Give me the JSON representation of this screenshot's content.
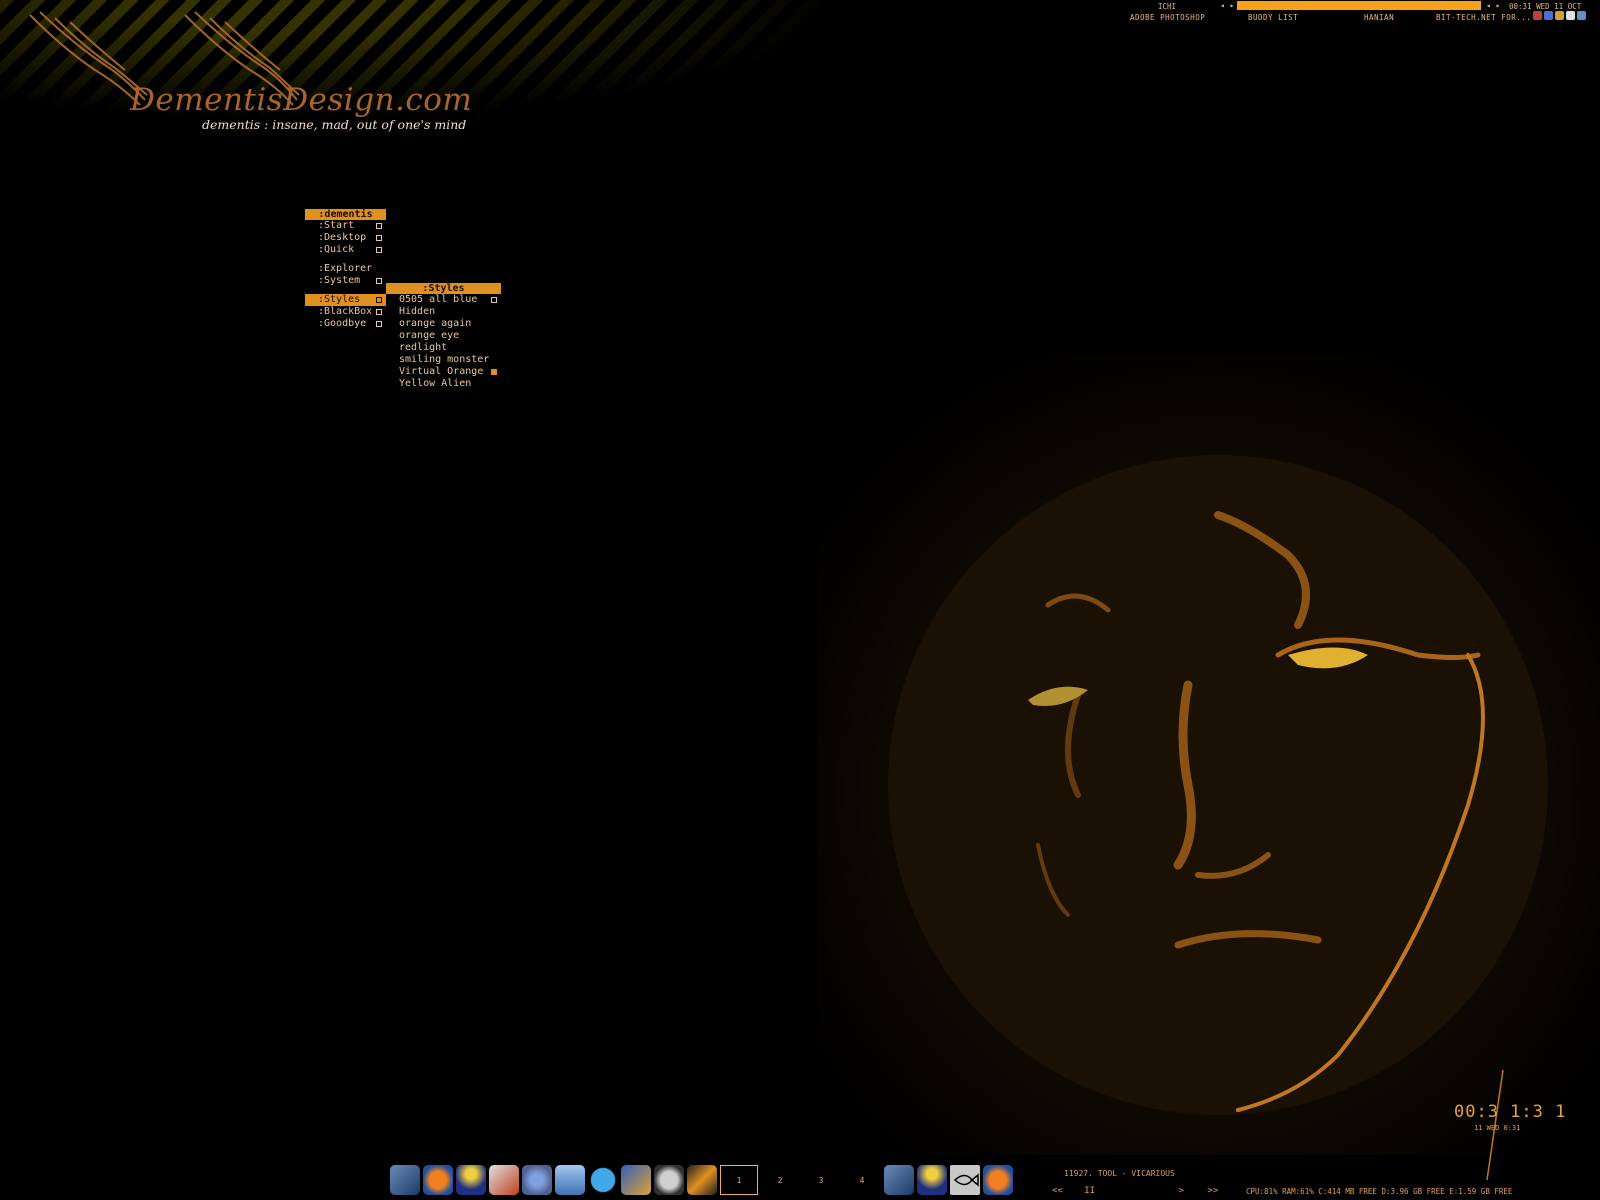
{
  "branding": {
    "logo": "DementisDesign.com",
    "tagline": "dementis : insane, mad, out of one's mind"
  },
  "topbar": {
    "workspace": "ICHI",
    "clock": "00:31 WED 11 OCT",
    "tasks": [
      "ADOBE PHOTOSHOP",
      "BUDDY LIST",
      "HANIAN",
      "BIT-TECH.NET FOR..."
    ]
  },
  "menu": {
    "title": ":dementis",
    "items": [
      ":Start",
      ":Desktop",
      ":Quick",
      ":Explorer",
      ":System",
      ":Styles",
      ":BlackBox",
      ":Goodbye"
    ]
  },
  "submenu": {
    "title": ":Styles",
    "items": [
      "0505 all blue",
      "Hidden",
      "orange again",
      "orange eye",
      "redlight",
      "smiling monster",
      "Virtual Orange",
      "Yellow Alien"
    ]
  },
  "dock": {
    "workspaces": [
      "1",
      "2",
      "3",
      "4"
    ],
    "current_workspace": "1",
    "icons": [
      "feather-icon",
      "firefox-icon",
      "aim-icon",
      "pen-icon",
      "itunes-icon",
      "notepad-icon",
      "skype-icon",
      "satellite-icon",
      "helmet-icon",
      "bolt-icon",
      "feather2-icon",
      "aim2-icon",
      "fish-icon",
      "firefox2-icon"
    ]
  },
  "player": {
    "now_playing": "11927. TOOL - VICARIOUS",
    "prev": "<<",
    "pause": "II",
    "next": ">",
    "next_track": ">>"
  },
  "status": {
    "stats": "CPU:81% RAM:61% C:414 MB FREE  D:3.96 GB FREE E:1.59 GB FREE"
  },
  "desktop_clock": {
    "time": "00:3 1:3 1",
    "date": "11 WED 0:31"
  },
  "colors": {
    "accent": "#e09020",
    "text": "#e8c898",
    "background": "#000000"
  }
}
